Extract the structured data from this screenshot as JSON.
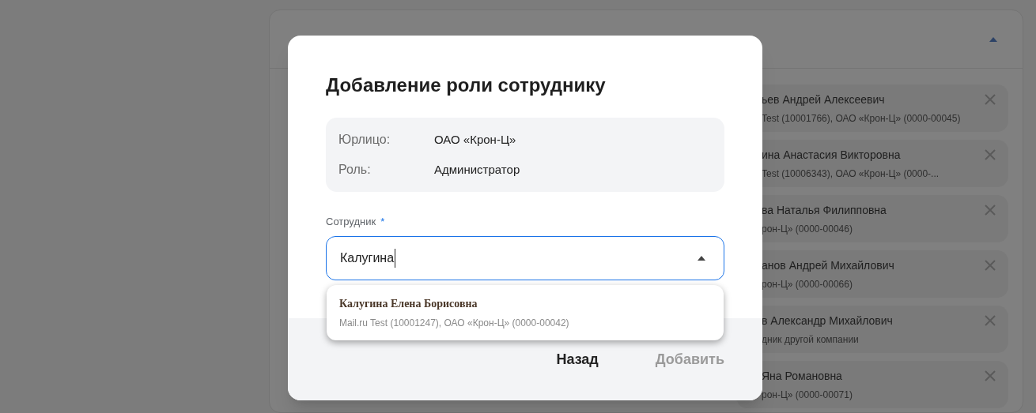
{
  "background": {
    "expanded": true,
    "employees": [
      {
        "name": "ьев Андрей Алексеевич",
        "detail": "Test (10001766), ОАО «Крон-Ц» (0000-00045)"
      },
      {
        "name": "ина Анастасия Викторовна",
        "detail": "Test (10006343), ОАО «Крон-Ц» (0000-..."
      },
      {
        "name": "ва Наталья Филипповна",
        "detail": "рон-Ц» (0000-00046)"
      },
      {
        "name": "анов Андрей Михайлович",
        "detail": "рон-Ц» (0000-00066)"
      },
      {
        "name": "в Александр Михайлович",
        "detail": "дник другой компании"
      },
      {
        "name": "Яна Романовна",
        "detail": "рон-Ц» (0000-00071)"
      }
    ]
  },
  "dialog": {
    "title": "Добавление роли сотруднику",
    "info": [
      {
        "label": "Юрлицо:",
        "value": "ОАО «Крон-Ц»"
      },
      {
        "label": "Роль:",
        "value": "Администратор"
      }
    ],
    "field": {
      "label": "Сотрудник",
      "required_mark": "*",
      "value": "Калугина",
      "expanded": true
    },
    "options": [
      {
        "name": "Калугина Елена Борисовна",
        "detail": "Mail.ru Test (10001247), ОАО «Крон-Ц» (0000-00042)"
      }
    ],
    "buttons": [
      {
        "label": "Назад",
        "disabled": false
      },
      {
        "label": "Добавить",
        "disabled": true
      }
    ]
  }
}
